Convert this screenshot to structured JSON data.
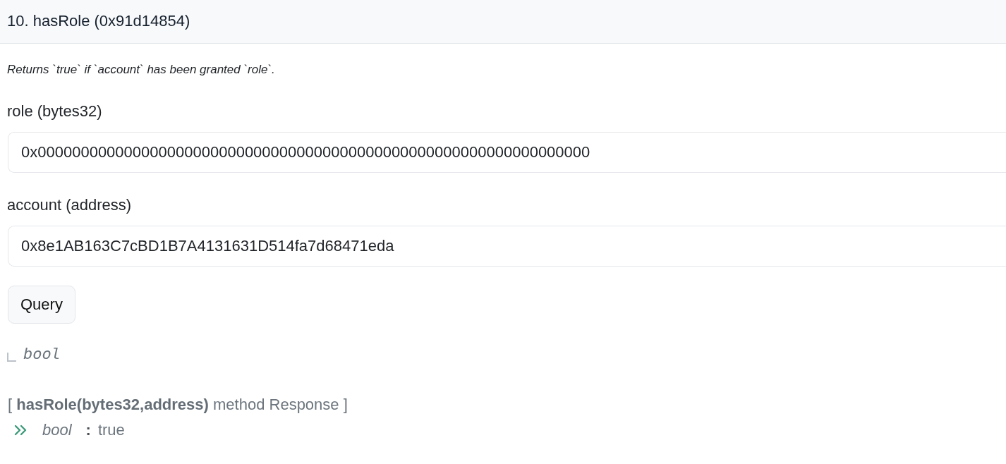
{
  "method": {
    "title": "10. hasRole (0x91d14854)",
    "description": "Returns `true` if `account` has been granted `role`."
  },
  "inputs": [
    {
      "label": "role (bytes32)",
      "value": "0x0000000000000000000000000000000000000000000000000000000000000000"
    },
    {
      "label": "account (address)",
      "value": "0x8e1AB163C7cBD1B7A4131631D514fa7d68471eda"
    }
  ],
  "query_button": {
    "label": "Query"
  },
  "outputs": [
    {
      "type": "bool"
    }
  ],
  "response": {
    "heading": "[ **hasRole(bytes32,address)** method Response ]",
    "results": [
      {
        "type": "bool",
        "separator": ":",
        "value": "true"
      }
    ]
  }
}
